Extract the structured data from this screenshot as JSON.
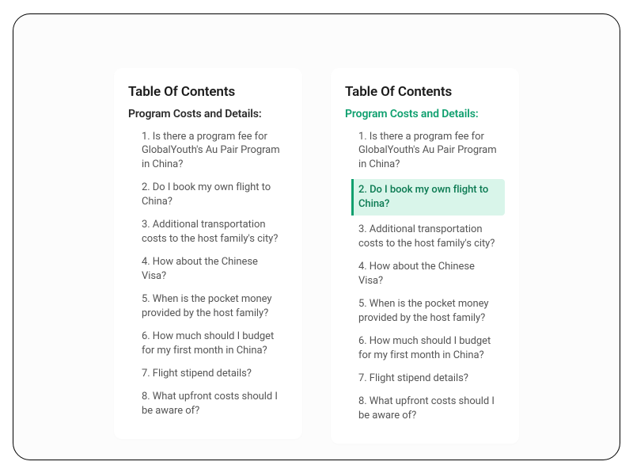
{
  "left": {
    "title": "Table Of Contents",
    "section": "Program Costs and Details:",
    "items": [
      "1. Is there a program fee for GlobalYouth's Au Pair Program in China?",
      "2. Do I book my own flight to China?",
      "3. Additional transportation costs to the host family's city?",
      "4. How about the Chinese Visa?",
      "5. When is the pocket money provided by the host family?",
      "6. How much should I budget for my first month in China?",
      "7. Flight stipend details?",
      "8. What upfront costs should I be aware of?"
    ]
  },
  "right": {
    "title": "Table Of Contents",
    "section": "Program Costs and Details:",
    "items": [
      "1. Is there a program fee for GlobalYouth's Au Pair Program in China?",
      "2. Do I book my own flight to China?",
      "3. Additional transportation costs to the host family's city?",
      "4. How about the Chinese Visa?",
      "5. When is the pocket money provided by the host family?",
      "6. How much should I budget for my first month in China?",
      "7. Flight stipend details?",
      "8. What upfront costs should I be aware of?"
    ],
    "active_index": 1
  }
}
